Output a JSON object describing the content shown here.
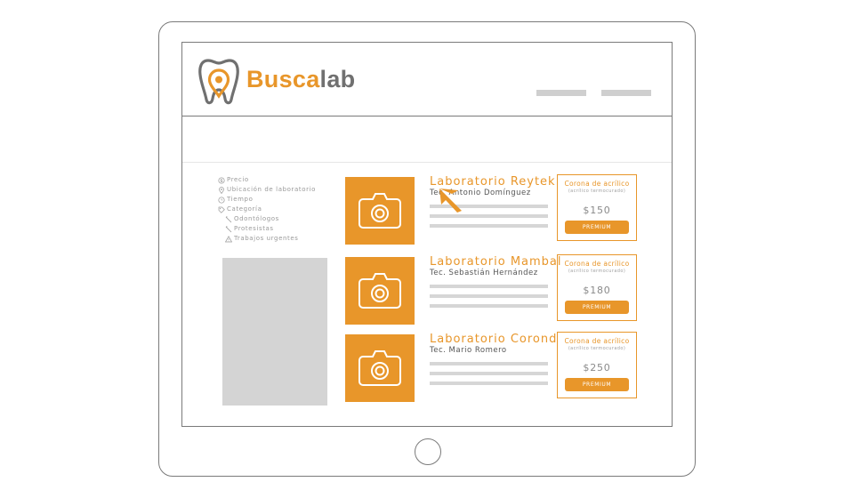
{
  "brand": {
    "part_a": "Busca",
    "part_b": "lab",
    "accent_color": "#e8962a",
    "secondary_color": "#707070"
  },
  "filters": [
    {
      "label": "Precio",
      "icon": "dollar-circle-icon",
      "sub": false
    },
    {
      "label": "Ubicación de laboratorio",
      "icon": "location-pin-icon",
      "sub": false
    },
    {
      "label": "Tiempo",
      "icon": "clock-icon",
      "sub": false
    },
    {
      "label": "Categoría",
      "icon": "tag-icon",
      "sub": false
    },
    {
      "label": "Odontólogos",
      "icon": "dental-tool-icon",
      "sub": true
    },
    {
      "label": "Protesistas",
      "icon": "dental-tool-icon",
      "sub": true
    },
    {
      "label": "Trabajos urgentes",
      "icon": "warning-icon",
      "sub": true
    }
  ],
  "labs": [
    {
      "name": "Laboratorio Reytek",
      "technician": "Tec. Antonio Domínguez",
      "product": "Corona de acrílico",
      "product_detail": "(acrílico termocurado)",
      "price": "$150",
      "button_label": "PREMIUM"
    },
    {
      "name": "Laboratorio Mambal",
      "technician": "Tec. Sebastián Hernández",
      "product": "Corona de acrílico",
      "product_detail": "(acrílico termocurado)",
      "price": "$180",
      "button_label": "PREMIUM"
    },
    {
      "name": "Laboratorio Corond",
      "technician": "Tec. Mario Romero",
      "product": "Corona de acrílico",
      "product_detail": "(acrílico termocurado)",
      "price": "$250",
      "button_label": "PREMIUM"
    }
  ]
}
